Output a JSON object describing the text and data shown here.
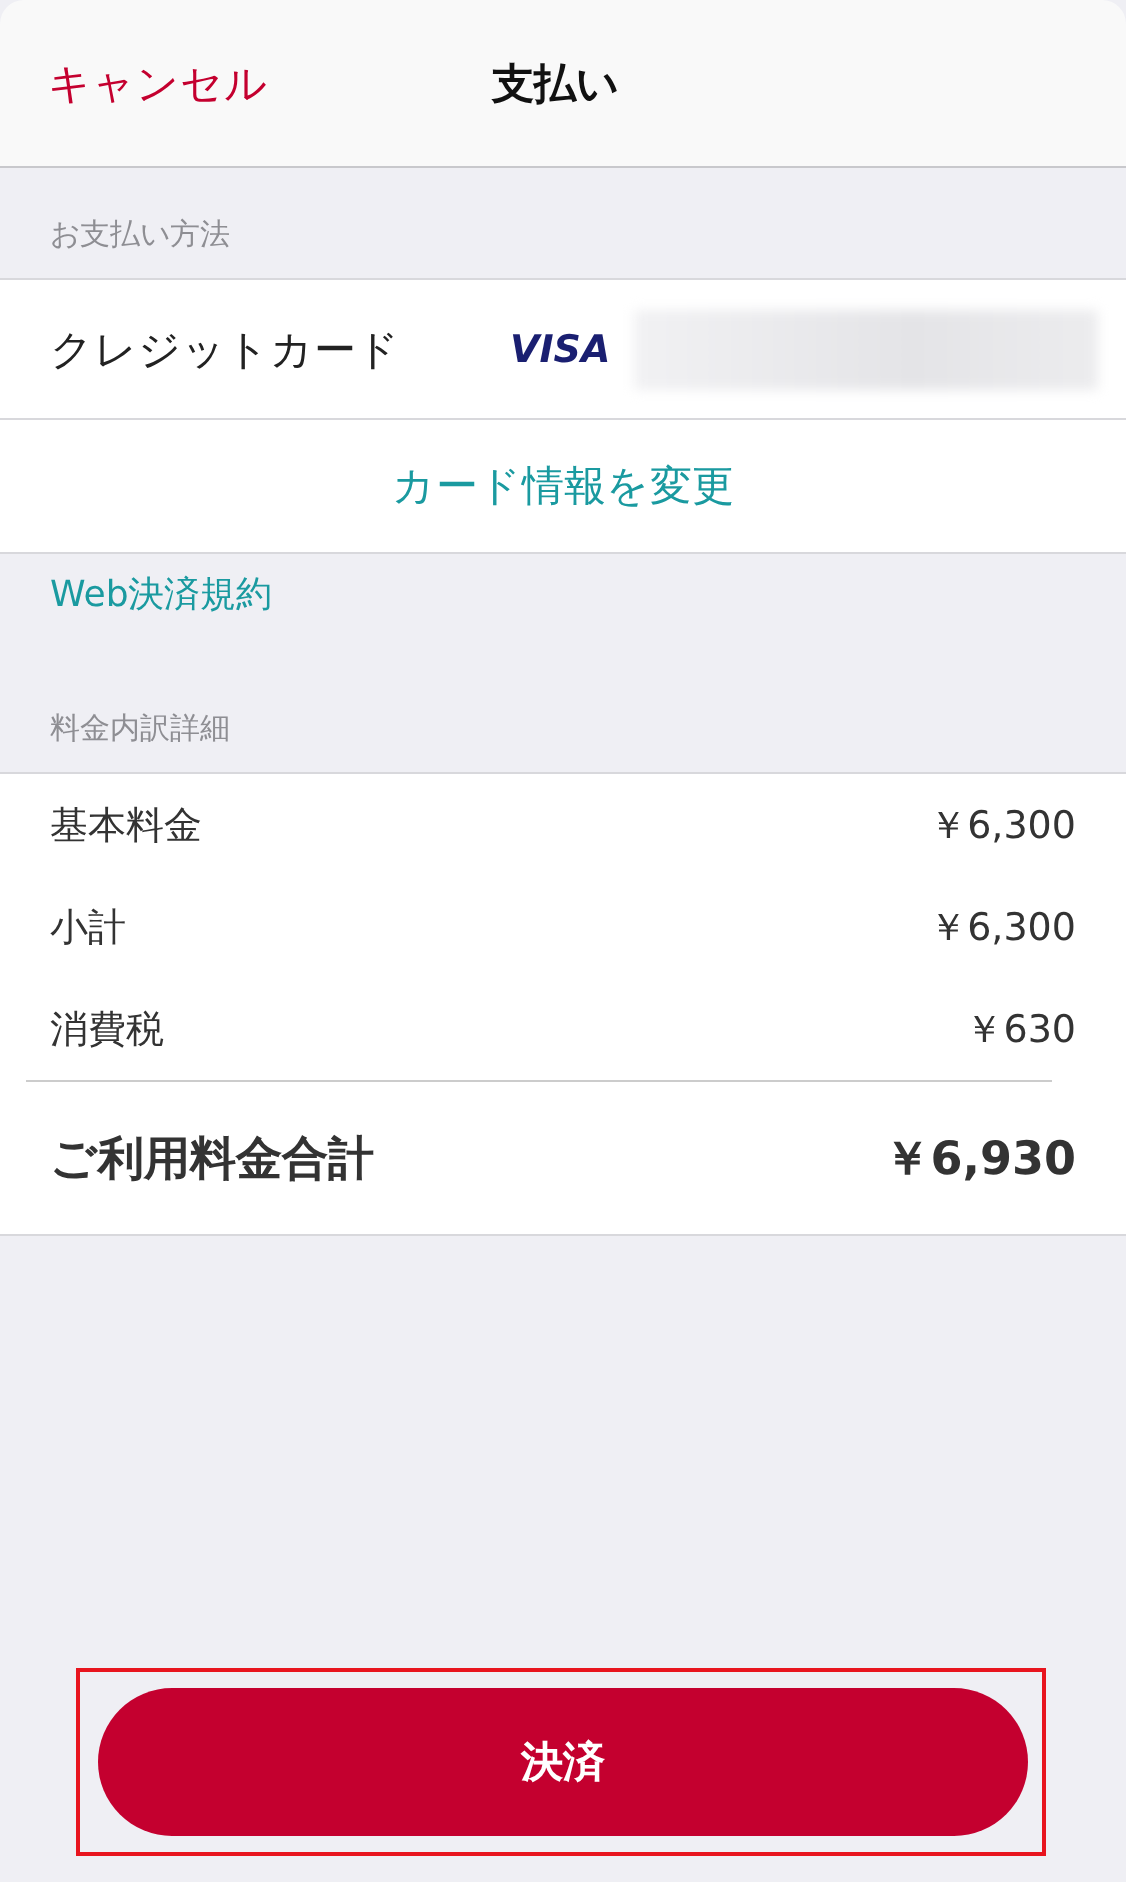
{
  "header": {
    "cancel": "キャンセル",
    "title": "支払い"
  },
  "payment": {
    "section": "お支払い方法",
    "method": "クレジットカード",
    "brand": "VISA",
    "change": "カード情報を変更"
  },
  "terms_link": "Web決済規約",
  "breakdown": {
    "section": "料金内訳詳細",
    "rows": [
      {
        "label": "基本料金",
        "value": "￥6,300"
      },
      {
        "label": "小計",
        "value": "￥6,300"
      },
      {
        "label": "消費税",
        "value": "￥630"
      }
    ],
    "total": {
      "label": "ご利用料金合計",
      "value": "￥6,930"
    }
  },
  "pay_button": {
    "label": "決済",
    "highlighted": true
  }
}
